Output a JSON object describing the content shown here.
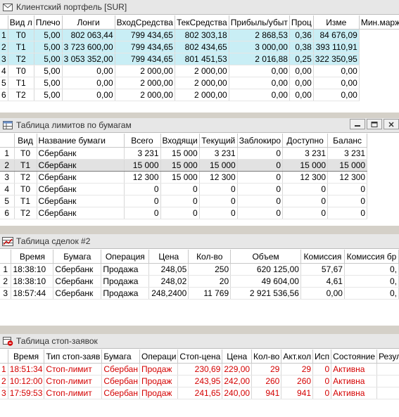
{
  "portfolio": {
    "title": "Клиентский портфель [SUR]",
    "icon": "envelope-icon",
    "columns": [
      "",
      "Вид л",
      "Плечо",
      "Лонги",
      "ВходСредства",
      "ТекСредства",
      "Прибыль/убыт",
      "Проц",
      "Изме",
      "Мин.маржа"
    ],
    "rows": [
      [
        "1",
        "T0",
        "5,00",
        "802 063,44",
        "799 434,65",
        "802 303,18",
        "2 868,53",
        "0,36",
        "84 676,09"
      ],
      [
        "2",
        "T1",
        "5,00",
        "3 723 600,00",
        "799 434,65",
        "802 434,65",
        "3 000,00",
        "0,38",
        "393 110,91"
      ],
      [
        "3",
        "T2",
        "5,00",
        "3 053 352,00",
        "799 434,65",
        "801 451,53",
        "2 016,88",
        "0,25",
        "322 350,95"
      ],
      [
        "4",
        "T0",
        "5,00",
        "0,00",
        "2 000,00",
        "2 000,00",
        "0,00",
        "0,00",
        "0,00"
      ],
      [
        "5",
        "T1",
        "5,00",
        "0,00",
        "2 000,00",
        "2 000,00",
        "0,00",
        "0,00",
        "0,00"
      ],
      [
        "6",
        "T2",
        "5,00",
        "0,00",
        "2 000,00",
        "2 000,00",
        "0,00",
        "0,00",
        "0,00"
      ]
    ]
  },
  "limits": {
    "title": "Таблица лимитов по бумагам",
    "icon": "table-icon",
    "columns": [
      "",
      "Вид",
      "Название бумаги",
      "Всего",
      "Входящи",
      "Текущий",
      "Заблокиро",
      "Доступно",
      "Баланс"
    ],
    "rows": [
      [
        "1",
        "T0",
        "Сбербанк",
        "3 231",
        "15 000",
        "3 231",
        "0",
        "3 231",
        "3 231"
      ],
      [
        "2",
        "T1",
        "Сбербанк",
        "15 000",
        "15 000",
        "15 000",
        "0",
        "15 000",
        "15 000"
      ],
      [
        "3",
        "T2",
        "Сбербанк",
        "12 300",
        "15 000",
        "12 300",
        "0",
        "12 300",
        "12 300"
      ],
      [
        "4",
        "T0",
        "Сбербанк",
        "0",
        "0",
        "0",
        "0",
        "0",
        "0"
      ],
      [
        "5",
        "T1",
        "Сбербанк",
        "0",
        "0",
        "0",
        "0",
        "0",
        "0"
      ],
      [
        "6",
        "T2",
        "Сбербанк",
        "0",
        "0",
        "0",
        "0",
        "0",
        "0"
      ]
    ],
    "buttons": [
      "minimize",
      "maximize",
      "close"
    ]
  },
  "deals": {
    "title": "Таблица сделок #2",
    "icon": "deals-icon",
    "columns": [
      "",
      "Время",
      "Бумага",
      "Операция",
      "Цена",
      "Кол-во",
      "Объем",
      "Комиссия",
      "Комиссия бр"
    ],
    "rows": [
      [
        "1",
        "18:38:10",
        "Сбербанк",
        "Продажа",
        "248,05",
        "250",
        "620 125,00",
        "57,67",
        "0,"
      ],
      [
        "2",
        "18:38:10",
        "Сбербанк",
        "Продажа",
        "248,02",
        "20",
        "49 604,00",
        "4,61",
        "0,"
      ],
      [
        "3",
        "18:57:44",
        "Сбербанк",
        "Продажа",
        "248,2400",
        "11 769",
        "2 921 536,56",
        "0,00",
        "0,"
      ]
    ]
  },
  "stops": {
    "title": "Таблица стоп-заявок",
    "icon": "stop-icon",
    "columns": [
      "",
      "Время",
      "Тип стоп-заяв",
      "Бумага",
      "Операци",
      "Стоп-цена",
      "Цена",
      "Кол-во",
      "Акт.кол",
      "Исп",
      "Состояние",
      "Резул"
    ],
    "rows": [
      [
        "1",
        "18:51:34",
        "Стоп-лимит",
        "Сбербан",
        "Продаж",
        "230,69",
        "229,00",
        "29",
        "29",
        "0",
        "Активна",
        ""
      ],
      [
        "2",
        "10:12:00",
        "Стоп-лимит",
        "Сбербан",
        "Продаж",
        "243,95",
        "242,00",
        "260",
        "260",
        "0",
        "Активна",
        ""
      ],
      [
        "3",
        "17:59:53",
        "Стоп-лимит",
        "Сбербан",
        "Продаж",
        "241,65",
        "240,00",
        "941",
        "941",
        "0",
        "Активна",
        ""
      ]
    ]
  },
  "colors": {
    "highlight": "#c9eef5",
    "selected": "#e2e2e2",
    "red_text": "#d40000"
  }
}
